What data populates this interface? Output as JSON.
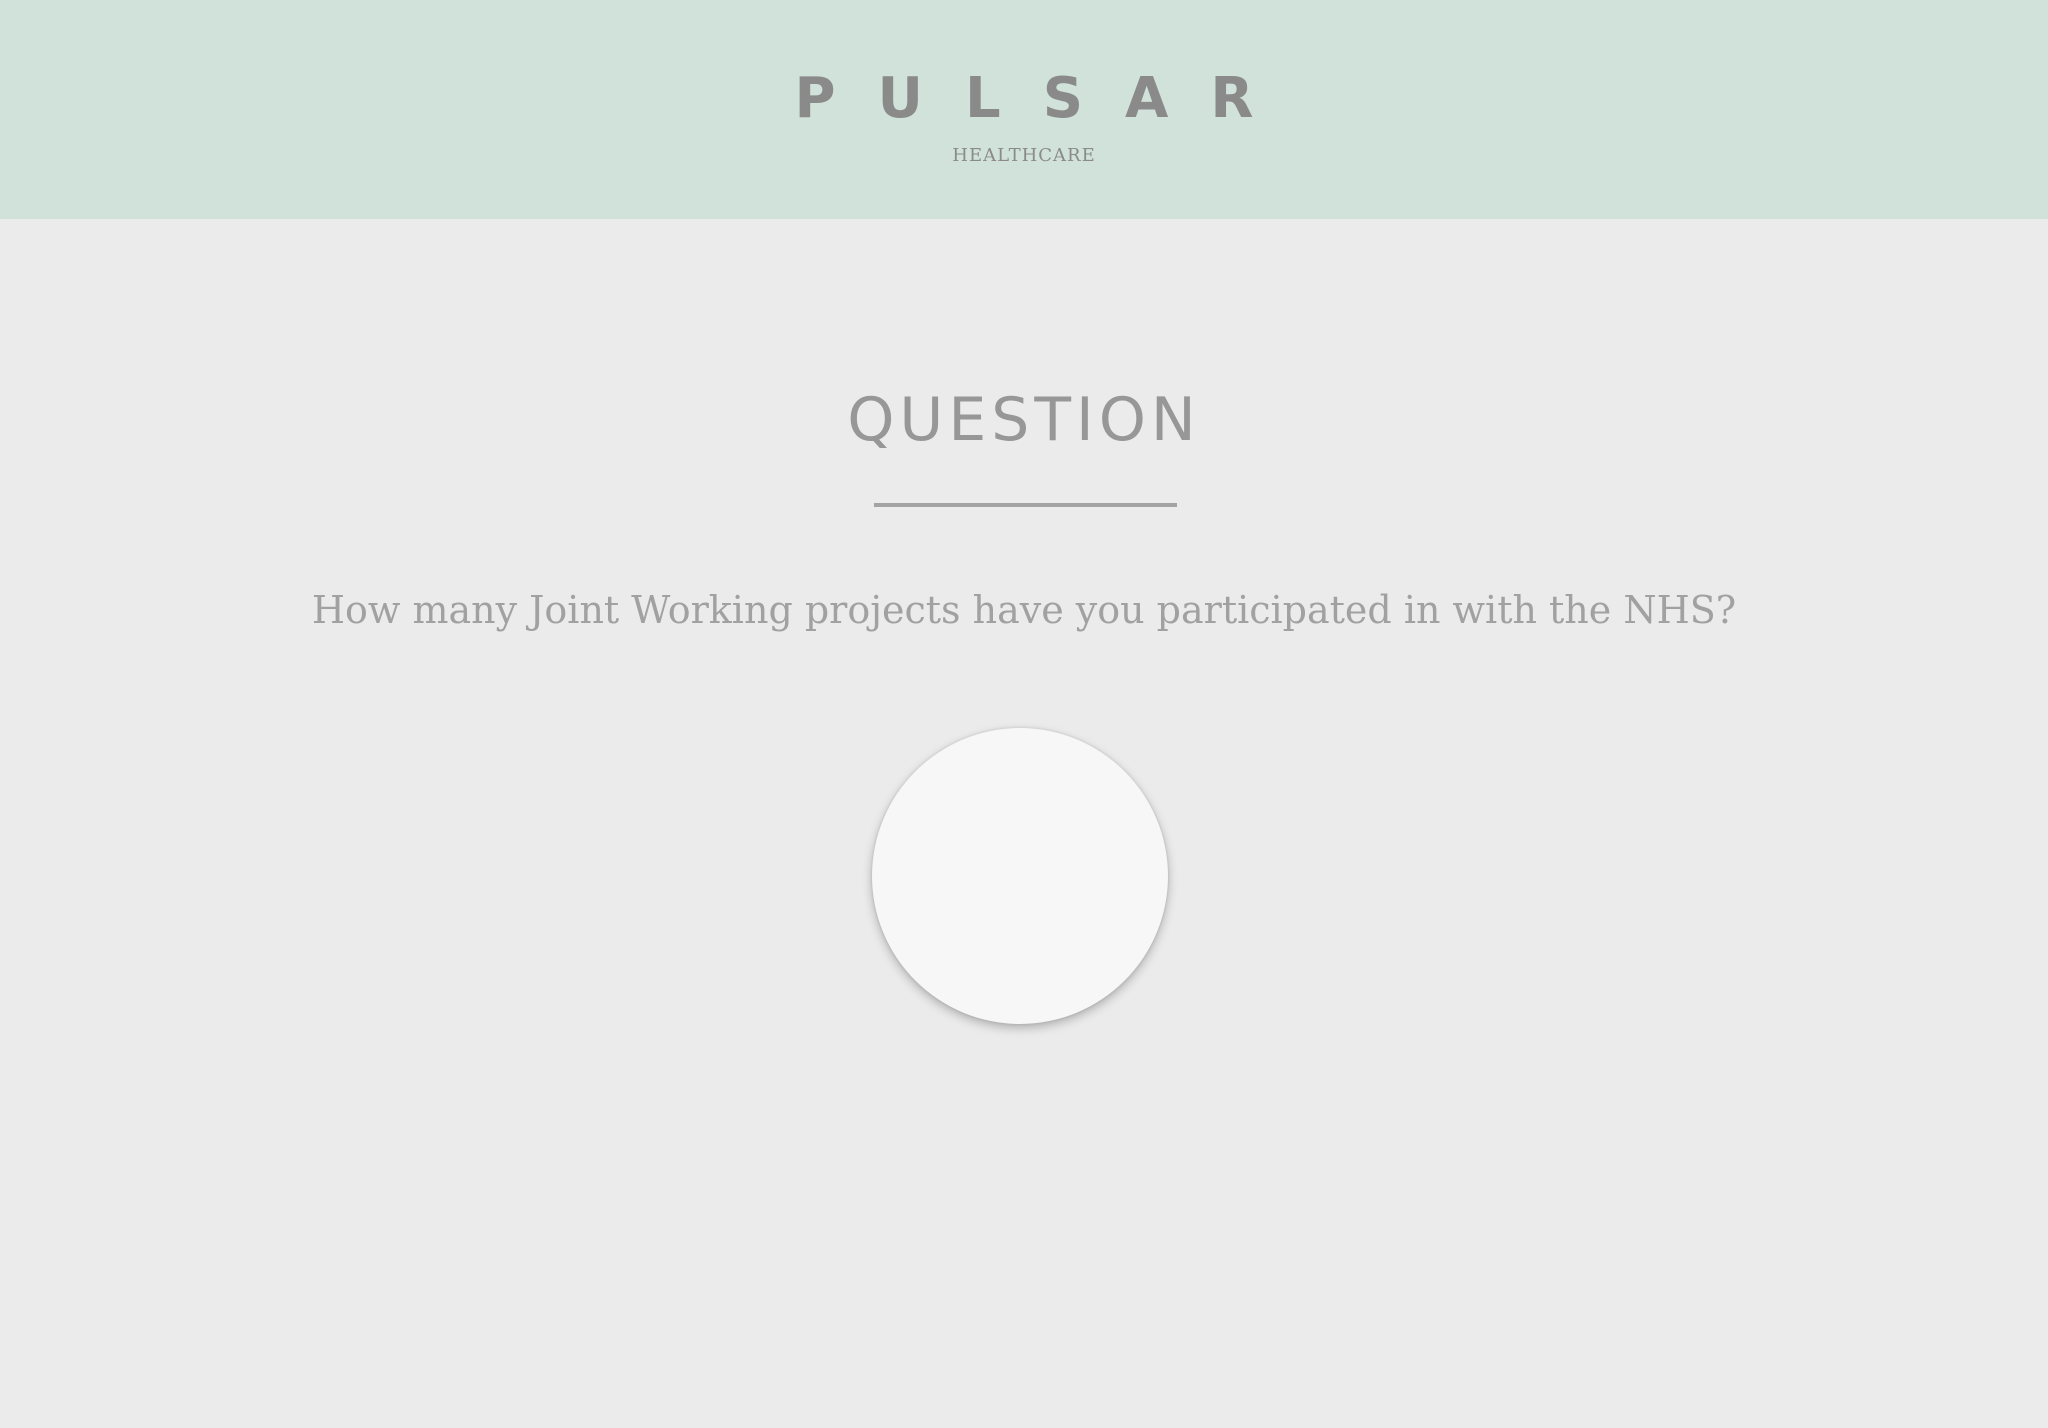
{
  "header": {
    "brand": "PULSAR",
    "subtitle": "HEALTHCARE",
    "background_color": "#d0e2da"
  },
  "main": {
    "section_heading": "QUESTION",
    "question": "How many Joint Working projects have you participated in with the NHS?",
    "answer_button_label": "",
    "background_color": "#ebebeb"
  }
}
